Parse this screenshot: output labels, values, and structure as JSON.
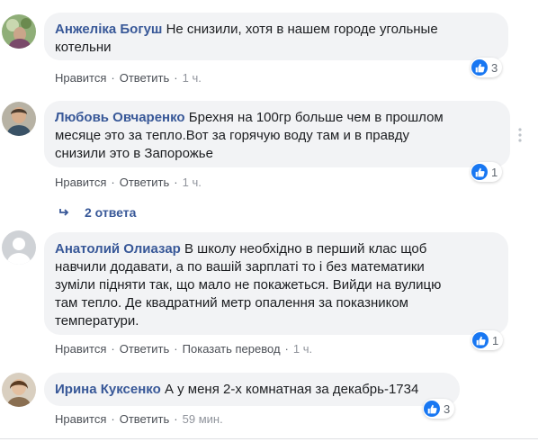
{
  "comments": [
    {
      "author": "Анжеліка Богуш",
      "text_lines": [
        "Не снизили, хотя в нашем городе угольные",
        "котельни"
      ],
      "actions": {
        "like": "Нравится",
        "reply": "Ответить",
        "time": "1 ч."
      },
      "reaction_count": "3"
    },
    {
      "author": "Любовь Овчаренко",
      "text_lines": [
        "Брехня на 100гр больше чем в прошлом",
        "месяце это за тепло.Вот за горячую воду там и в правду",
        "снизили это в Запорожье"
      ],
      "actions": {
        "like": "Нравится",
        "reply": "Ответить",
        "time": "1 ч."
      },
      "reaction_count": "1",
      "replies_label": "2 ответа"
    },
    {
      "author": "Анатолий Олиазар",
      "text_lines": [
        "В школу необхідно в перший клас щоб",
        "навчили додавати, а по вашій зарплаті то і без математики",
        "зуміли підняти так, що мало не покажеться. Вийди на вулицю",
        "там тепло. Де квадратний метр опалення за показником",
        "температури."
      ],
      "actions": {
        "like": "Нравится",
        "reply": "Ответить",
        "translate": "Показать перевод",
        "time": "1 ч."
      },
      "reaction_count": "1"
    },
    {
      "author": "Ирина Куксенко",
      "text_lines": [
        "А у меня 2-х комнатная за декабрь-1734"
      ],
      "actions": {
        "like": "Нравится",
        "reply": "Ответить",
        "time": "59 мин."
      },
      "reaction_count": "3"
    }
  ],
  "colors": {
    "author": "#385898",
    "bubble": "#f2f3f5",
    "like_blue": "#1877f2"
  },
  "icons": [
    "like-icon",
    "reply-arrow-icon",
    "more-options-icon"
  ]
}
